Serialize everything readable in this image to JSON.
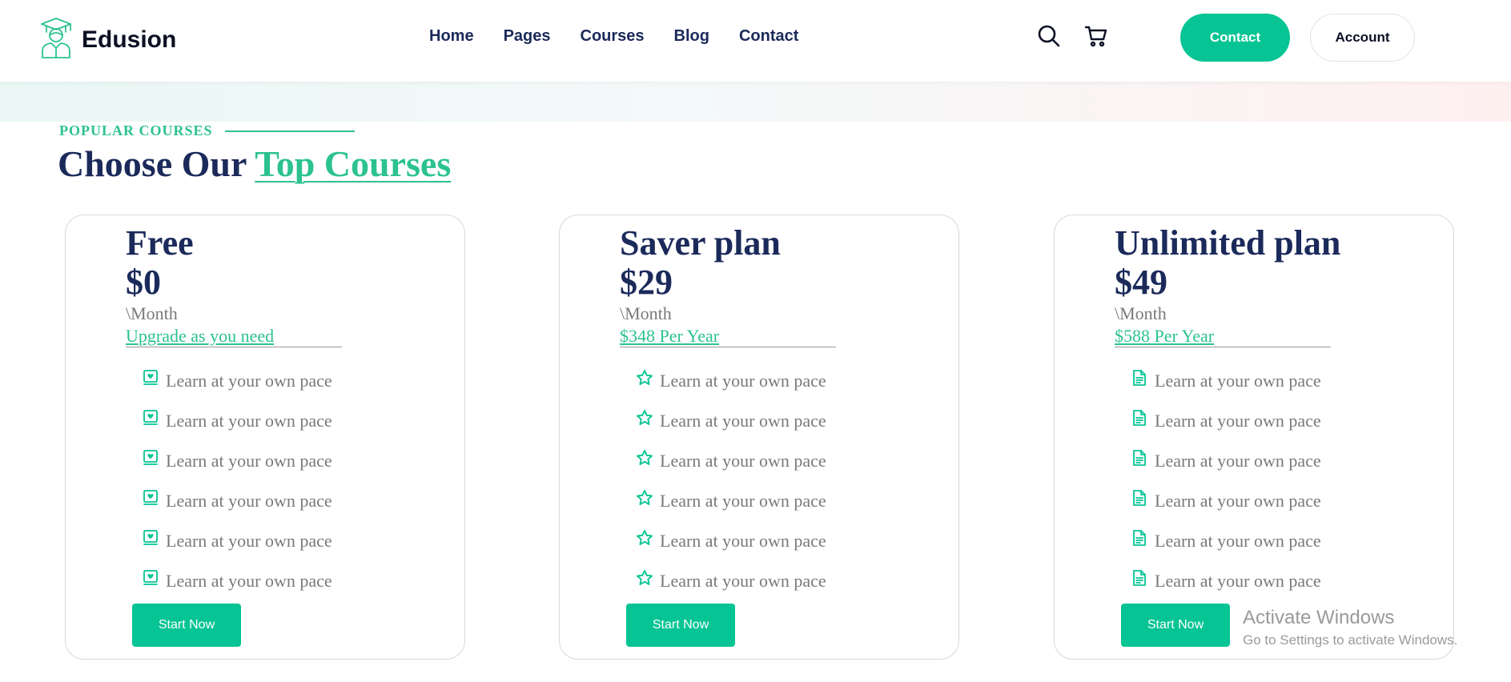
{
  "brand": {
    "name": "Edusion",
    "logo_icon": "graduate-icon",
    "accent": "#2cc28e",
    "button_color": "#06c494",
    "heading_color": "#1b2a5a"
  },
  "nav": {
    "items": [
      "Home",
      "Pages",
      "Courses",
      "Blog",
      "Contact"
    ]
  },
  "header": {
    "search_icon": "search-icon",
    "cart_icon": "cart-icon",
    "contact_label": "Contact",
    "account_label": "Account"
  },
  "section": {
    "eyebrow": "POPULAR COURSES",
    "title_prefix": "Choose Our ",
    "title_accent": "Top Courses"
  },
  "plans": [
    {
      "name": "Free",
      "price": "$0",
      "period": "\\Month",
      "note": "Upgrade as you need",
      "feature_icon": "book-heart-icon",
      "features": [
        "Learn at your own pace",
        "Learn at your own pace",
        "Learn at your own pace",
        "Learn at your own pace",
        "Learn at your own pace",
        "Learn at your own pace"
      ],
      "cta": "Start Now"
    },
    {
      "name": "Saver plan",
      "price": "$29",
      "period": "\\Month",
      "note": "$348 Per Year",
      "feature_icon": "star-icon",
      "features": [
        "Learn at your own pace",
        "Learn at your own pace",
        "Learn at your own pace",
        "Learn at your own pace",
        "Learn at your own pace",
        "Learn at your own pace"
      ],
      "cta": "Start Now"
    },
    {
      "name": "Unlimited plan",
      "price": "$49",
      "period": "\\Month",
      "note": "$588 Per Year",
      "feature_icon": "document-icon",
      "features": [
        "Learn at your own pace",
        "Learn at your own pace",
        "Learn at your own pace",
        "Learn at your own pace",
        "Learn at your own pace",
        "Learn at your own pace"
      ],
      "cta": "Start Now"
    }
  ],
  "watermark": {
    "title": "Activate Windows",
    "subtitle": "Go to Settings to activate Windows."
  }
}
